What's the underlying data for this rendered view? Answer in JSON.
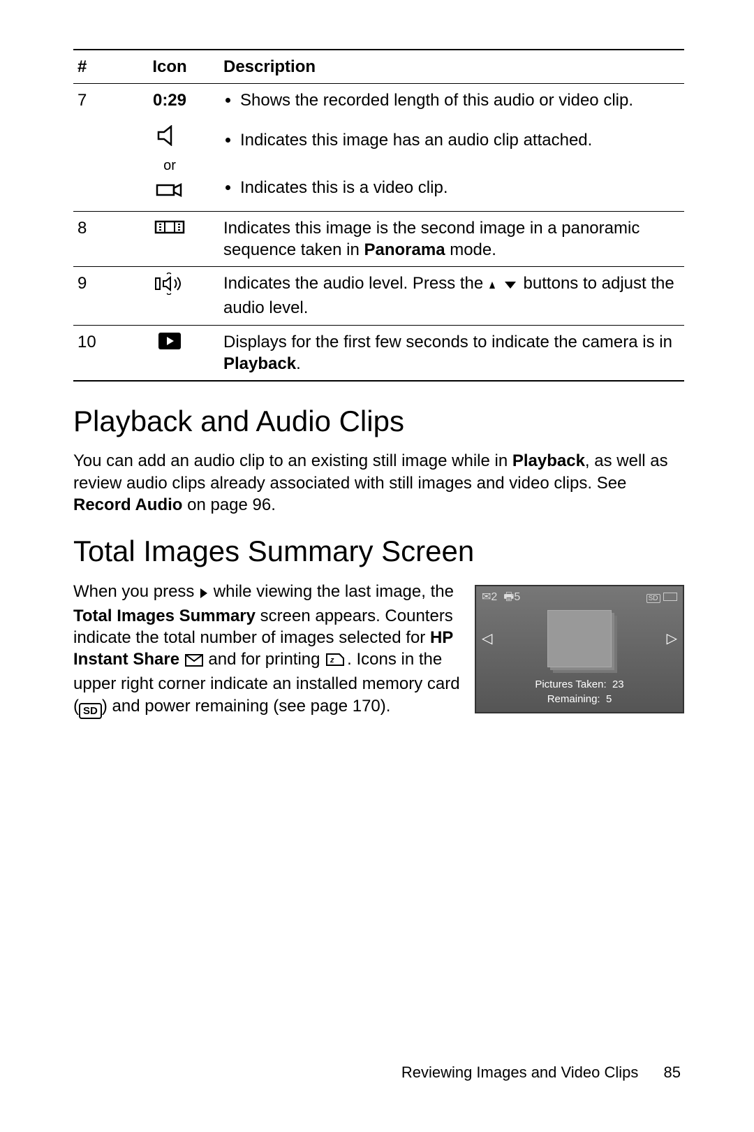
{
  "table": {
    "headers": {
      "num": "#",
      "icon": "Icon",
      "desc": "Description"
    },
    "row7": {
      "num": "7",
      "icon_time": "0:29",
      "icon_or": "or",
      "bullets": [
        "Shows the recorded length of this audio or video clip.",
        "Indicates this image has an audio clip attached.",
        "Indicates this is a video clip."
      ]
    },
    "row8": {
      "num": "8",
      "desc_pre": "Indicates this image is the second image in a panoramic sequence taken in ",
      "desc_bold": "Panorama",
      "desc_post": " mode."
    },
    "row9": {
      "num": "9",
      "desc_pre": "Indicates the audio level. Press the ",
      "desc_post": " buttons to adjust the audio level."
    },
    "row10": {
      "num": "10",
      "desc_pre": "Displays for the first few seconds to indicate the camera is in ",
      "desc_bold": "Playback",
      "desc_post": "."
    }
  },
  "section1": {
    "heading": "Playback and Audio Clips",
    "p_pre": "You can add an audio clip to an existing still image while in ",
    "p_b1": "Playback",
    "p_mid": ", as well as review audio clips already associated with still images and video clips. See ",
    "p_b2": "Record Audio",
    "p_post": " on page 96."
  },
  "section2": {
    "heading": "Total Images Summary Screen",
    "p1_pre": "When you press ",
    "p1_mid1": " while viewing the last image, the ",
    "p1_b1": "Total Images Summary",
    "p1_mid2": " screen appears. Counters indicate the total number of images selected for ",
    "p1_b2": "HP Instant Share",
    "p1_mid3": " and for printing ",
    "p1_mid4": ". Icons in the upper right corner indicate an installed memory card (",
    "p1_sd": "SD",
    "p1_post": ") and power remaining (see page 170)."
  },
  "summary_screen": {
    "top_left_mail": "2",
    "top_left_print": "5",
    "pictures_label": "Pictures Taken:",
    "pictures_value": "23",
    "remaining_label": "Remaining:",
    "remaining_value": "5"
  },
  "footer": {
    "chapter": "Reviewing Images and Video Clips",
    "page": "85"
  }
}
